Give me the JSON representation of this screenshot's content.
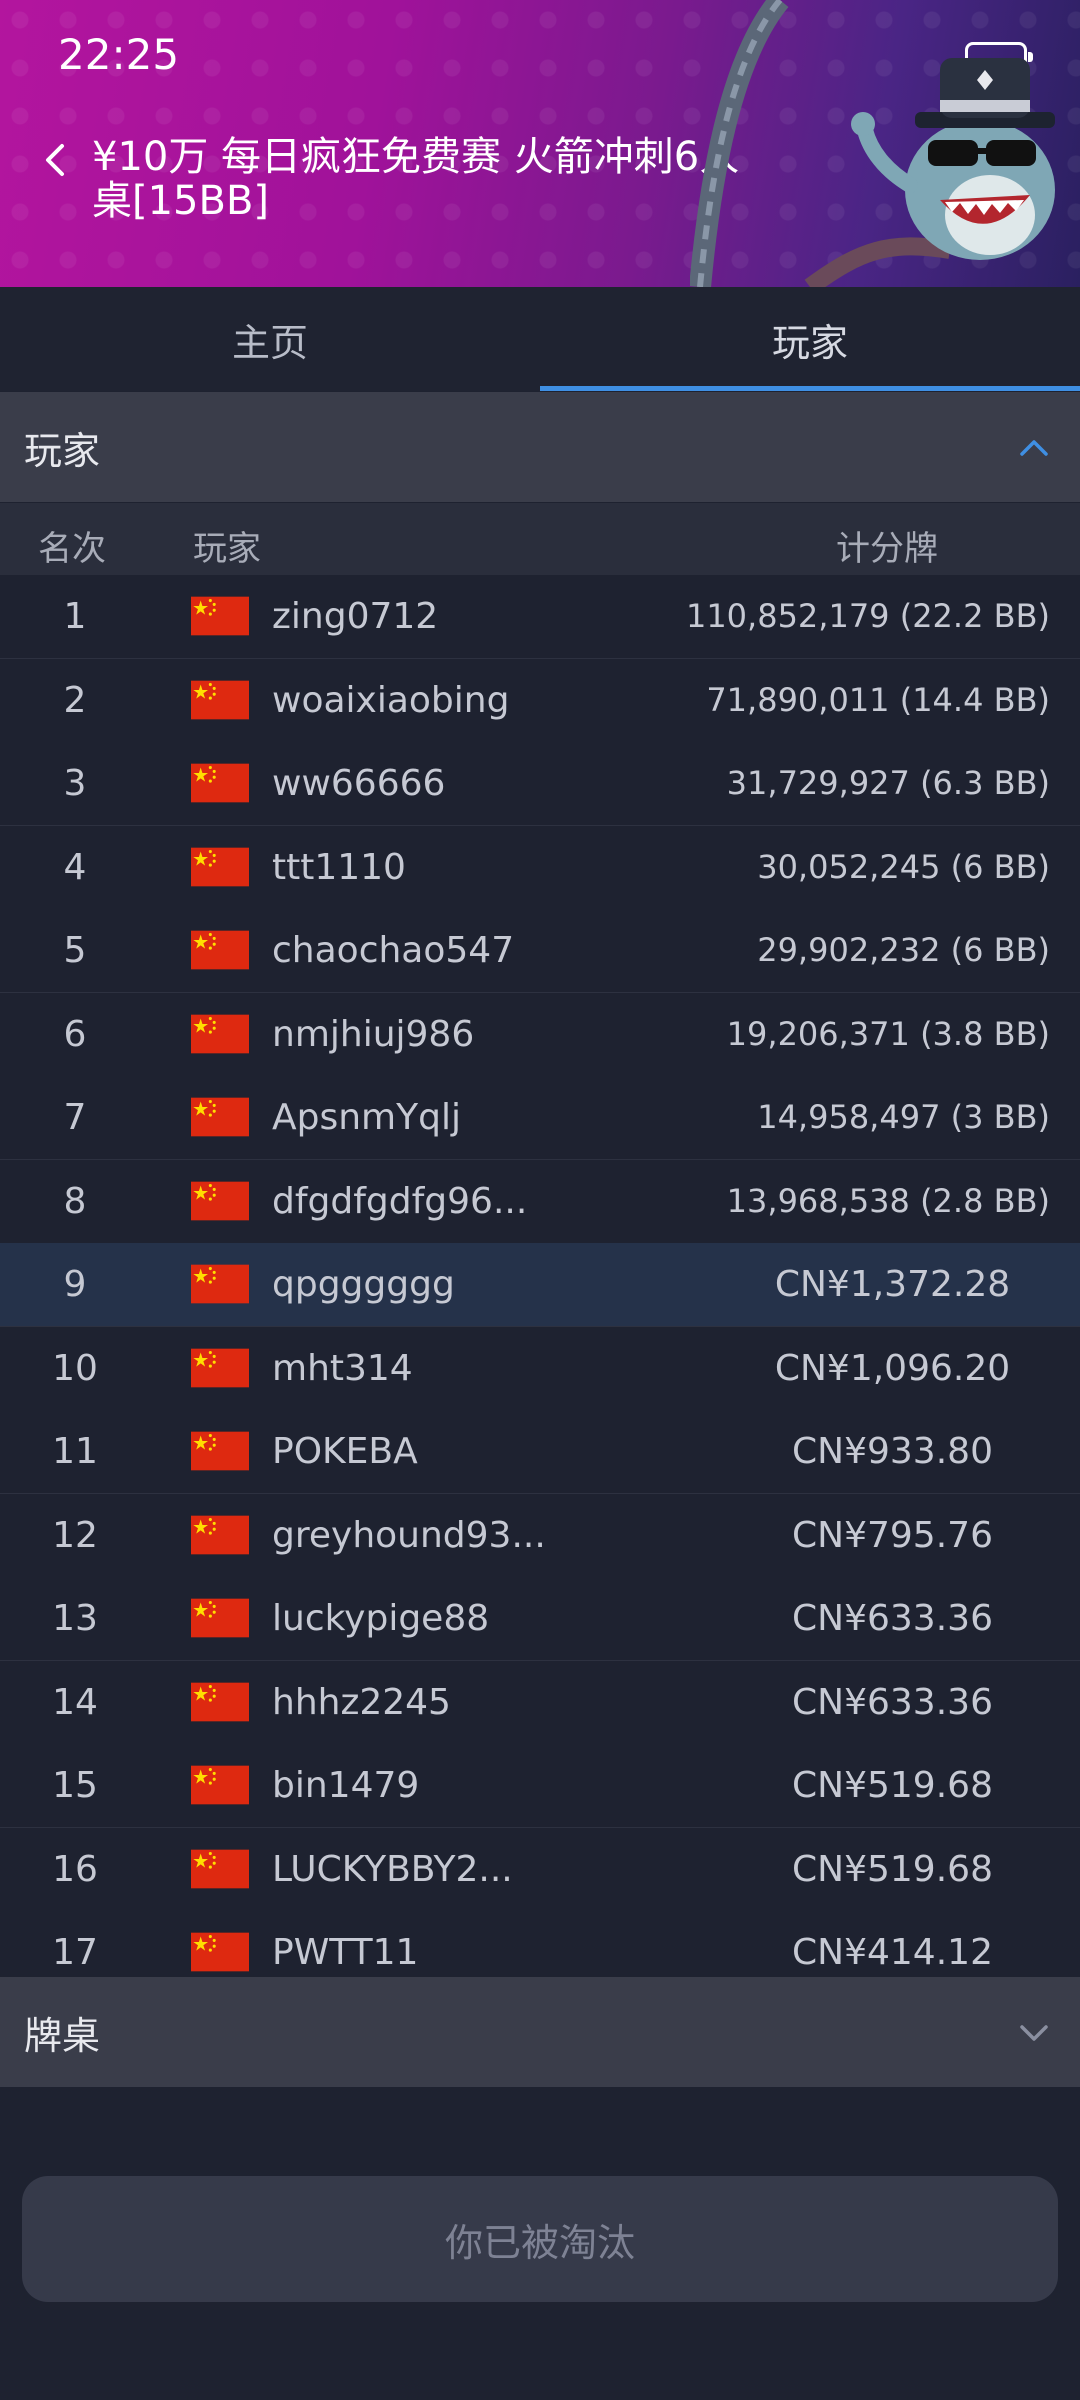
{
  "status": {
    "time": "22:25"
  },
  "header": {
    "title": "¥10万 每日疯狂免费赛 火箭冲刺6人桌[15BB]"
  },
  "tabs": [
    {
      "label": "主页",
      "active": false
    },
    {
      "label": "玩家",
      "active": true
    }
  ],
  "players_section": {
    "label": "玩家",
    "expanded": true
  },
  "columns": {
    "rank": "名次",
    "player": "玩家",
    "chips": "计分牌"
  },
  "rows": [
    {
      "rank": "1",
      "name": "zing0712",
      "score": "110,852,179 (22.2 BB)"
    },
    {
      "rank": "2",
      "name": "woaixiaobing",
      "score": "71,890,011 (14.4 BB)"
    },
    {
      "rank": "3",
      "name": "ww66666",
      "score": "31,729,927 (6.3 BB)"
    },
    {
      "rank": "4",
      "name": "ttt1110",
      "score": "30,052,245 (6 BB)"
    },
    {
      "rank": "5",
      "name": "chaochao547",
      "score": "29,902,232 (6 BB)"
    },
    {
      "rank": "6",
      "name": "nmjhiuj986",
      "score": "19,206,371 (3.8 BB)"
    },
    {
      "rank": "7",
      "name": "ApsnmYqlj",
      "score": "14,958,497 (3 BB)"
    },
    {
      "rank": "8",
      "name": "dfgdfgdfg96...",
      "score": "13,968,538 (2.8 BB)"
    },
    {
      "rank": "9",
      "name": "qpgggggg",
      "score": "CN¥1,372.28"
    },
    {
      "rank": "10",
      "name": "mht314",
      "score": "CN¥1,096.20"
    },
    {
      "rank": "11",
      "name": "POKEBA",
      "score": "CN¥933.80"
    },
    {
      "rank": "12",
      "name": "greyhound93...",
      "score": "CN¥795.76"
    },
    {
      "rank": "13",
      "name": "luckypige88",
      "score": "CN¥633.36"
    },
    {
      "rank": "14",
      "name": "hhhz2245",
      "score": "CN¥633.36"
    },
    {
      "rank": "15",
      "name": "bin1479",
      "score": "CN¥519.68"
    },
    {
      "rank": "16",
      "name": "LUCKYBBY2...",
      "score": "CN¥519.68"
    },
    {
      "rank": "17",
      "name": "PWTT11",
      "score": "CN¥414.12"
    }
  ],
  "tables_section": {
    "label": "牌桌",
    "expanded": false
  },
  "eliminated_button": {
    "label": "你已被淘汰"
  },
  "colors": {
    "accent": "#3f8fe3",
    "background": "#1e2230",
    "highlight_row": "#25324a"
  }
}
